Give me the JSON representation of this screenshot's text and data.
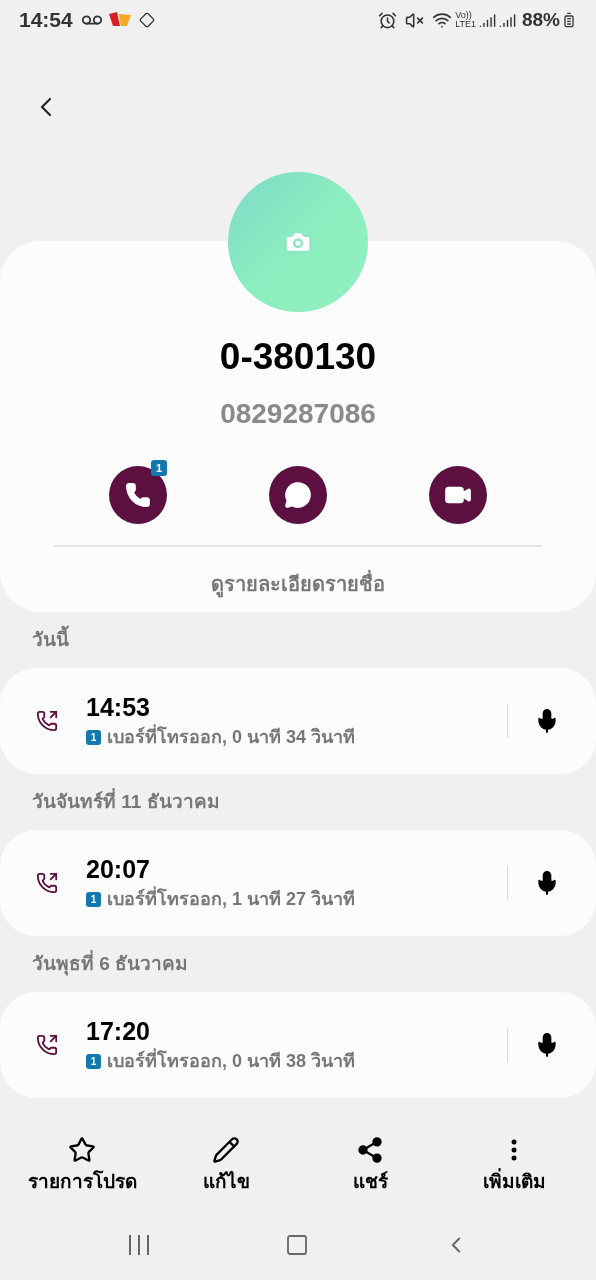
{
  "status_bar": {
    "time": "14:54",
    "volte": "Vo))",
    "lte": "LTE1",
    "battery": "88%"
  },
  "contact": {
    "name": "0-380130",
    "number": "0829287086",
    "call_badge": "1",
    "details_link": "ดูรายละเอียดรายชื่อ"
  },
  "call_log": [
    {
      "heading": "วันนี้",
      "time": "14:53",
      "sim": "1",
      "detail": "เบอร์ที่โทรออก, 0 นาที 34 วินาที"
    },
    {
      "heading": "วันจันทร์ที่ 11 ธันวาคม",
      "time": "20:07",
      "sim": "1",
      "detail": "เบอร์ที่โทรออก, 1 นาที 27 วินาที"
    },
    {
      "heading": "วันพุธที่ 6 ธันวาคม",
      "time": "17:20",
      "sim": "1",
      "detail": "เบอร์ที่โทรออก, 0 นาที 38 วินาที"
    }
  ],
  "toolbar": [
    {
      "kind": "star",
      "label": "รายการโปรด"
    },
    {
      "kind": "edit",
      "label": "แก้ไข"
    },
    {
      "kind": "share",
      "label": "แชร์"
    },
    {
      "kind": "more",
      "label": "เพิ่มเติม"
    }
  ]
}
